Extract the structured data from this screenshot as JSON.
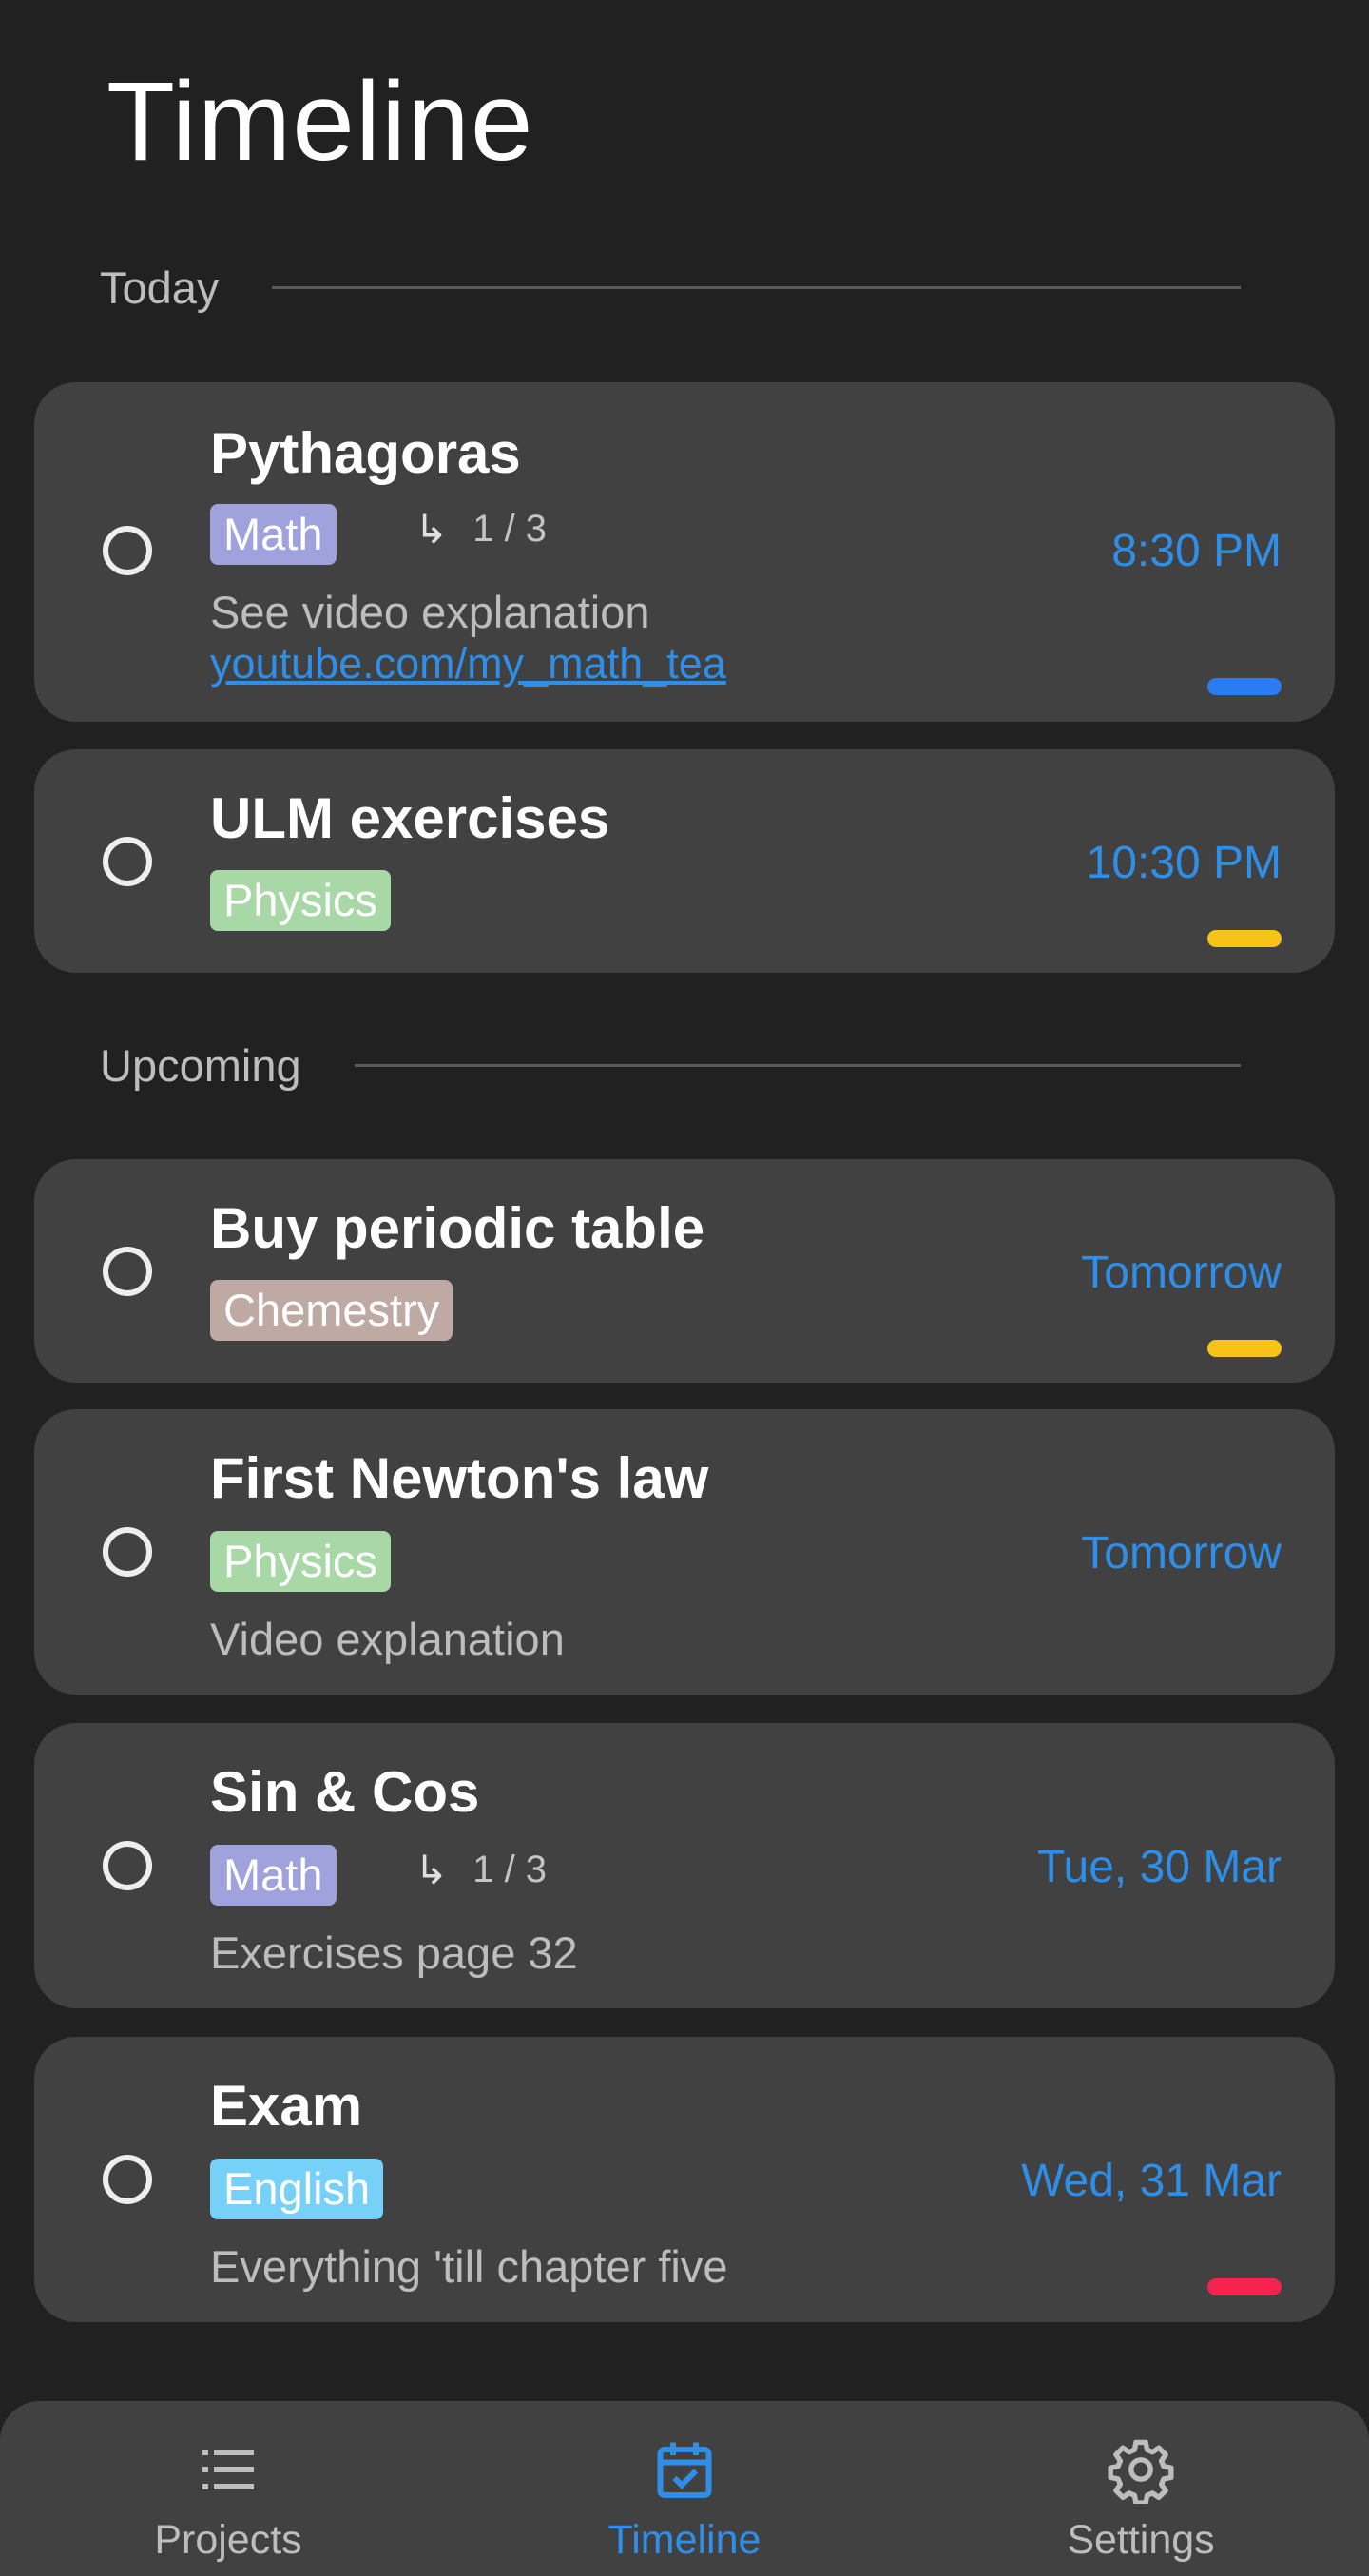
{
  "header": {
    "title": "Timeline"
  },
  "sections": {
    "today": "Today",
    "upcoming": "Upcoming"
  },
  "colors": {
    "accent": "#2f8fe8",
    "tag_math": "#9fa2dc",
    "tag_physics": "#a7d8a6",
    "tag_chemistry": "#bfaaa3",
    "tag_english": "#76d0f7",
    "priority_blue": "#2a7cf0",
    "priority_yellow": "#f7c317",
    "priority_red": "#f5214f"
  },
  "tasks": [
    {
      "title": "Pythagoras",
      "tag": "Math",
      "subtasks_icon": "subtask-arrow-icon",
      "subtasks": "1 / 3",
      "description": "See video explanation",
      "link": "youtube.com/my_math_tea",
      "due": "8:30 PM",
      "priority": "blue"
    },
    {
      "title": "ULM exercises",
      "tag": "Physics",
      "due": "10:30 PM",
      "priority": "yellow"
    },
    {
      "title": "Buy periodic table",
      "tag": "Chemestry",
      "due": "Tomorrow",
      "priority": "yellow"
    },
    {
      "title": "First Newton's law",
      "tag": "Physics",
      "description": "Video explanation",
      "due": "Tomorrow"
    },
    {
      "title": "Sin & Cos",
      "tag": "Math",
      "subtasks_icon": "subtask-arrow-icon",
      "subtasks": "1 / 3",
      "description": "Exercises page 32",
      "due": "Tue, 30 Mar"
    },
    {
      "title": "Exam",
      "tag": "English",
      "description": "Everything 'till chapter five",
      "due": "Wed, 31 Mar",
      "priority": "red"
    }
  ],
  "nav": {
    "items": [
      {
        "label": "Projects",
        "icon": "list-icon"
      },
      {
        "label": "Timeline",
        "icon": "calendar-check-icon",
        "active": true
      },
      {
        "label": "Settings",
        "icon": "gear-icon"
      }
    ]
  }
}
